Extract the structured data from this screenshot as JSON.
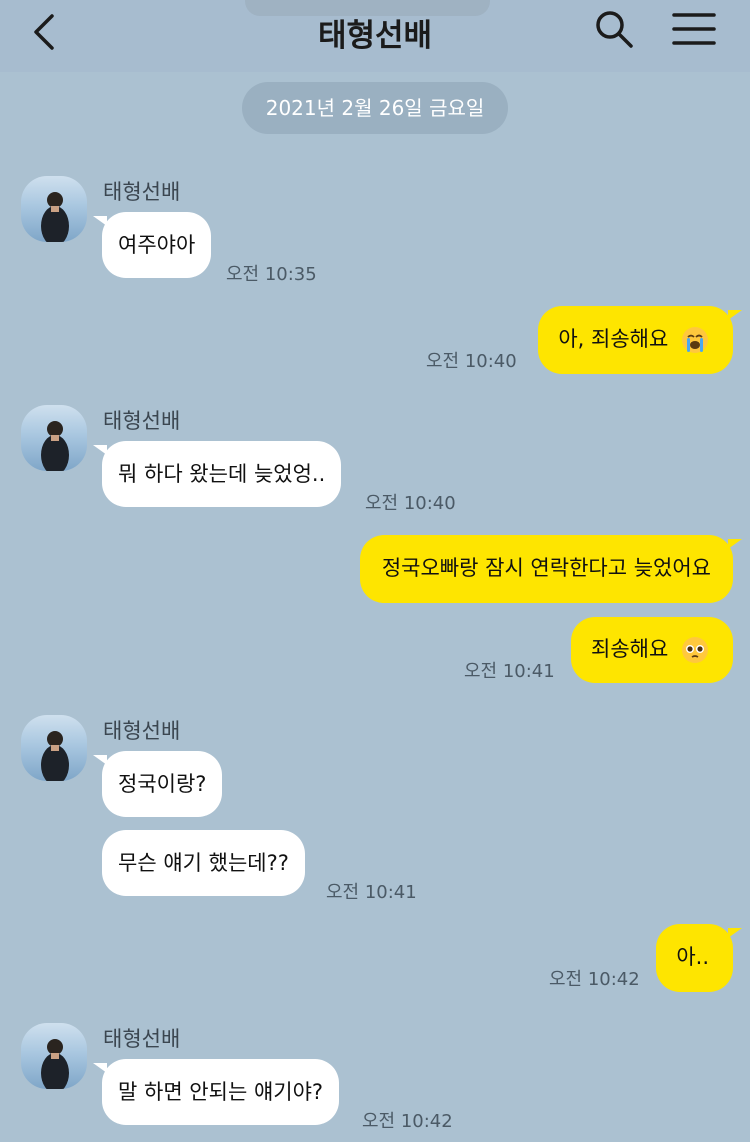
{
  "header": {
    "title": "태형선배"
  },
  "date_divider": "2021년 2월 26일 금요일",
  "messages": [
    {
      "sender": "태형선배",
      "text": "여주야아",
      "time": "오전 10:35"
    },
    {
      "text": "아, 죄송해요",
      "emoji": "loudly-crying-face",
      "time": "오전 10:40"
    },
    {
      "sender": "태형선배",
      "text": "뭐 하다 왔는데 늦었엉..",
      "time": "오전 10:40"
    },
    {
      "text": "정국오빠랑 잠시 연락한다고 늦었어요"
    },
    {
      "text": "죄송해요",
      "emoji": "pleading-face",
      "time": "오전 10:41"
    },
    {
      "sender": "태형선배",
      "text": "정국이랑?"
    },
    {
      "text": "무슨 얘기 했는데??",
      "time": "오전 10:41"
    },
    {
      "text": "아..",
      "time": "오전 10:42"
    },
    {
      "sender": "태형선배",
      "text": "말 하면 안되는 얘기야?",
      "time": "오전 10:42"
    }
  ]
}
